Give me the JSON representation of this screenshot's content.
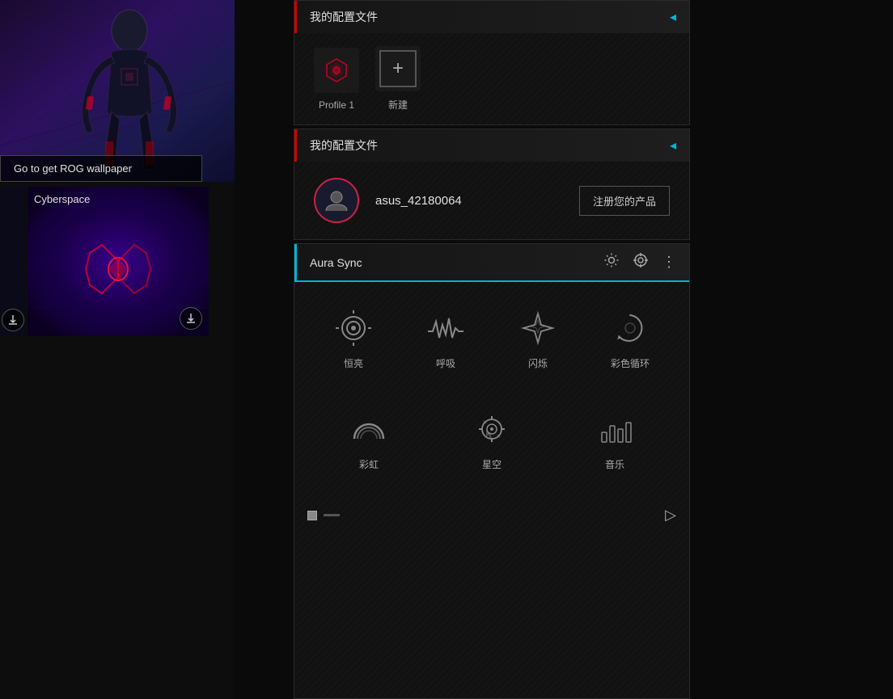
{
  "app": {
    "background": "#0a0a0a"
  },
  "left_panel": {
    "wallpaper_btn": "Go to get ROG wallpaper",
    "thumb1_label": "Cyberspace",
    "thumb1_has_download": true,
    "thumb2_has_download": true
  },
  "profiles": {
    "title": "我的配置文件",
    "profile1_label": "Profile 1",
    "add_label": "新建"
  },
  "myconfig": {
    "title": "我的配置文件",
    "username": "asus_42180064",
    "register_btn": "注册您的产品"
  },
  "aura": {
    "title": "Aura Sync",
    "items": [
      {
        "label": "恒亮",
        "icon": "circle-dot"
      },
      {
        "label": "呼吸",
        "icon": "wave"
      },
      {
        "label": "闪烁",
        "icon": "star-four"
      },
      {
        "label": "彩色循环",
        "icon": "spinner-arc"
      },
      {
        "label": "彩虹",
        "icon": "rainbow"
      },
      {
        "label": "星空",
        "icon": "crosshair-spin"
      },
      {
        "label": "音乐",
        "icon": "bars-music"
      }
    ]
  }
}
